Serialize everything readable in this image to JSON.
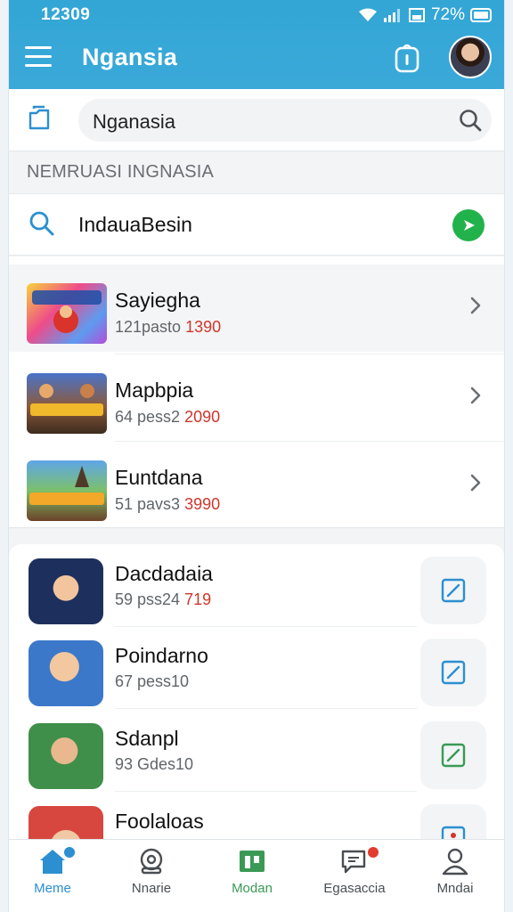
{
  "status_bar": {
    "time": "12309",
    "battery": "72%"
  },
  "header": {
    "title": "Ngansia"
  },
  "search": {
    "value": "Nganasia"
  },
  "section": {
    "label": "NEMRUASI INGNASIA"
  },
  "filter": {
    "label": "IndauaBesin"
  },
  "list_primary": [
    {
      "title": "Sayiegha",
      "sub_prefix": "121pasto ",
      "sub_value": "1390"
    },
    {
      "title": "Mapbpia",
      "sub_prefix": "64 pess2 ",
      "sub_value": "2090"
    },
    {
      "title": "Euntdana",
      "sub_prefix": "51 pavs3 ",
      "sub_value": "3990"
    }
  ],
  "list_secondary": [
    {
      "title": "Dacdadaia",
      "sub_prefix": "59 pss24 ",
      "sub_value": "719"
    },
    {
      "title": "Poindarno",
      "sub_prefix": "67 pess10",
      "sub_value": ""
    },
    {
      "title": "Sdanpl",
      "sub_prefix": "93 Gdes10",
      "sub_value": ""
    },
    {
      "title": "Foolaloas",
      "sub_prefix": "",
      "sub_value": ""
    }
  ],
  "bottom_nav": [
    {
      "label": "Meme"
    },
    {
      "label": "Nnarie"
    },
    {
      "label": "Modan"
    },
    {
      "label": "Egasaccia"
    },
    {
      "label": "Mndai"
    }
  ],
  "colors": {
    "header": "#33a6d6",
    "accent": "#2b8fd0",
    "red": "#d0362b",
    "green": "#22b24c"
  }
}
